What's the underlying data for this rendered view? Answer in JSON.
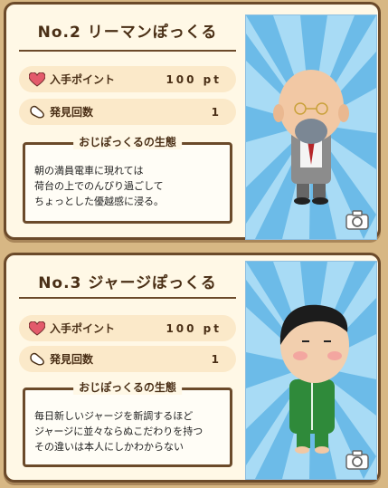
{
  "cards": [
    {
      "title": "No.2 リーマンぽっくる",
      "points_label": "入手ポイント",
      "points_value": "100 pt",
      "count_label": "発見回数",
      "count_value": "1",
      "ecology_heading": "おじぽっくるの生態",
      "ecology_lines": [
        "朝の満員電車に現れては",
        "荷台の上でのんびり過ごして",
        "ちょっとした優越感に浸る。"
      ]
    },
    {
      "title": "No.3 ジャージぽっくる",
      "points_label": "入手ポイント",
      "points_value": "100 pt",
      "count_label": "発見回数",
      "count_value": "1",
      "ecology_heading": "おじぽっくるの生態",
      "ecology_lines": [
        "毎日新しいジャージを新調するほど",
        "ジャージに並々ならぬこだわりを持つ",
        "その違いは本人にしかわからない"
      ]
    }
  ],
  "icons": {
    "points": "heart-icon",
    "count": "footprint-icon",
    "camera": "camera-icon"
  },
  "colors": {
    "card_bg": "#fff8e6",
    "border": "#6b4a2a",
    "pill_bg": "#fbe9c9",
    "heart": "#e35a6b",
    "sky": "#7cc4ec"
  }
}
